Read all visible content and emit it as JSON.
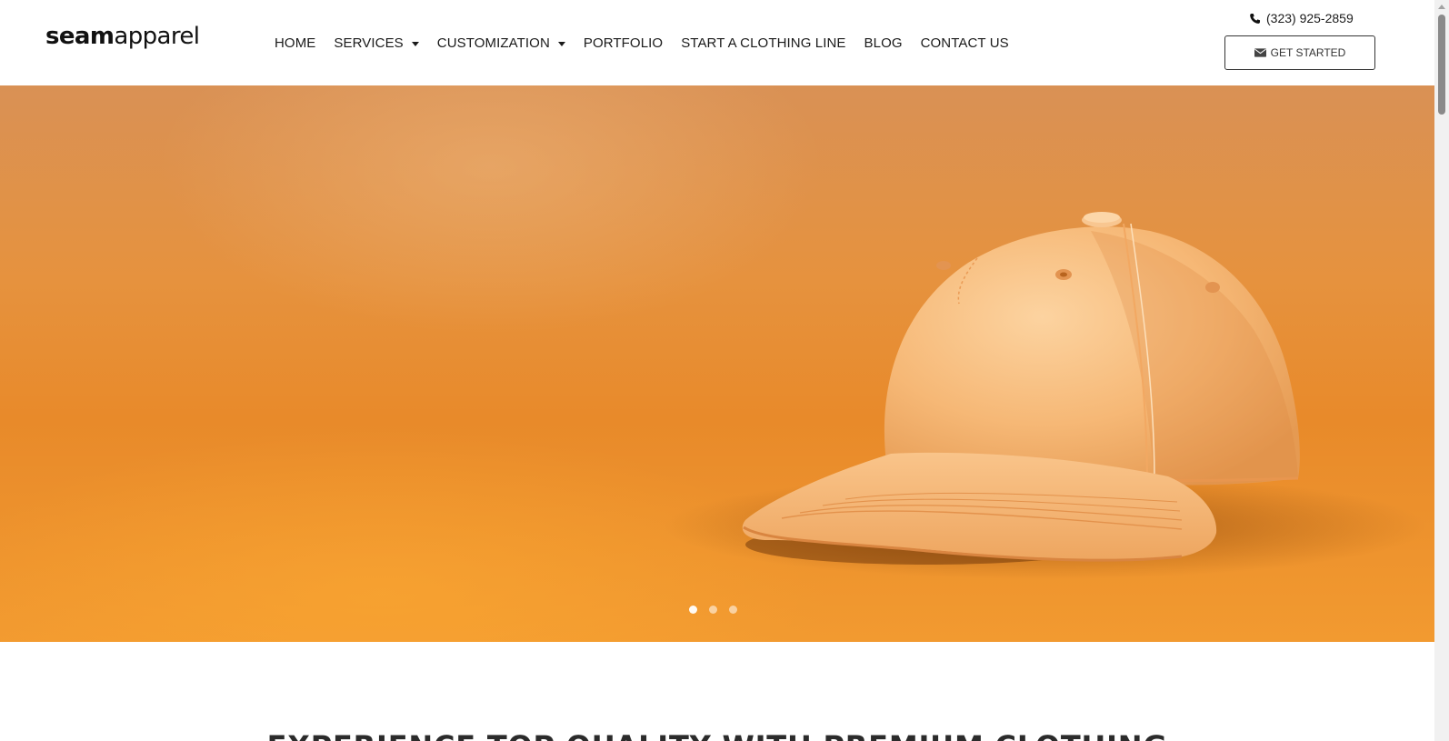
{
  "brand": {
    "logo_bold": "seam",
    "logo_light": "apparel"
  },
  "nav": {
    "items": [
      {
        "label": "HOME",
        "dropdown": false
      },
      {
        "label": "SERVICES",
        "dropdown": true
      },
      {
        "label": "CUSTOMIZATION",
        "dropdown": true
      },
      {
        "label": "PORTFOLIO",
        "dropdown": false
      },
      {
        "label": "START A CLOTHING LINE",
        "dropdown": false
      },
      {
        "label": "BLOG",
        "dropdown": false
      },
      {
        "label": "CONTACT US",
        "dropdown": false
      }
    ]
  },
  "contact": {
    "phone": "(323) 925-2859",
    "cta_label": "GET STARTED"
  },
  "hero": {
    "slide_count": 3,
    "active_slide": 1,
    "background_color": "#e88a2a",
    "cap_color": "#f6b46e"
  },
  "headline": {
    "text": "EXPERIENCE TOP QUALITY WITH PREMIUM CLOTHING"
  },
  "icons": {
    "phone": "phone-icon",
    "mail": "envelope-icon",
    "dropdown": "caret-down-icon"
  }
}
